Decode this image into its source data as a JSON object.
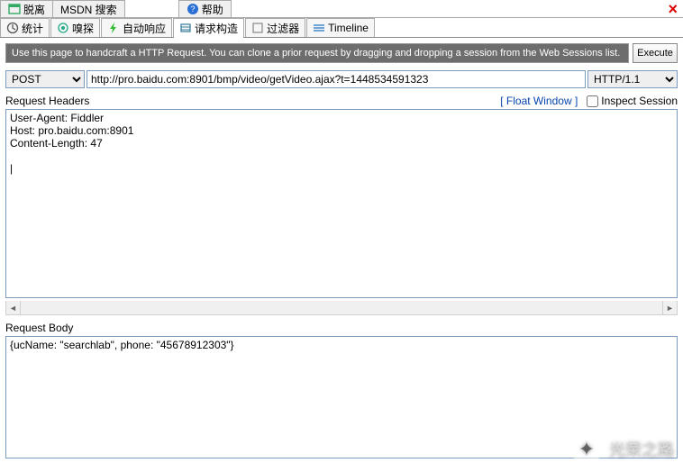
{
  "top_tabs": {
    "detach": "脱离",
    "msdn": "MSDN 搜索",
    "help": "帮助"
  },
  "sub_tabs": {
    "stats": "统计",
    "inspect": "嗅探",
    "auto_respond": "自动响应",
    "composer": "请求构造",
    "filters": "过滤器",
    "timeline": "Timeline"
  },
  "instruction_text": "Use this page to handcraft a HTTP Request.  You can clone a prior request by dragging and dropping a session from the Web Sessions list.",
  "execute_label": "Execute",
  "method": "POST",
  "url": "http://pro.baidu.com:8901/bmp/video/getVideo.ajax?t=1448534591323",
  "protocol": "HTTP/1.1",
  "headers_section": {
    "title": "Request Headers",
    "float_link": "[ Float Window ]",
    "inspect_label": "Inspect Session",
    "content": "User-Agent: Fiddler\nHost: pro.baidu.com:8901\nContent-Length: 47\n\n|"
  },
  "body_section": {
    "title": "Request Body",
    "content": "{ucName: \"searchlab\", phone: \"45678912303\"}"
  },
  "watermark": "光荣之路"
}
